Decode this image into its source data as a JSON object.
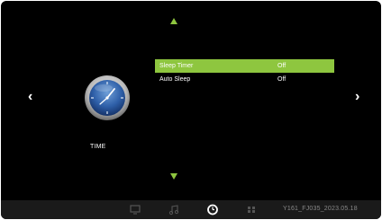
{
  "colors": {
    "accent": "#8ec63f",
    "background": "#000000",
    "bottom_bar": "#1a1a1a",
    "inactive_icon": "#555555"
  },
  "nav": {
    "left": "‹",
    "right": "›"
  },
  "section": {
    "label": "TIME",
    "icon": "clock-icon"
  },
  "menu": {
    "items": [
      {
        "label": "Sleep Timer",
        "value": "Off",
        "selected": true
      },
      {
        "label": "Auto Sleep",
        "value": "Off",
        "selected": false
      }
    ]
  },
  "tabs": [
    {
      "name": "tv",
      "icon": "tv-icon",
      "active": false
    },
    {
      "name": "music",
      "icon": "music-icon",
      "active": false
    },
    {
      "name": "time",
      "icon": "clock-icon",
      "active": true
    },
    {
      "name": "lock",
      "icon": "grid-icon",
      "active": false
    }
  ],
  "footer": {
    "version": "Y161_FJ035_2023.05.18"
  }
}
